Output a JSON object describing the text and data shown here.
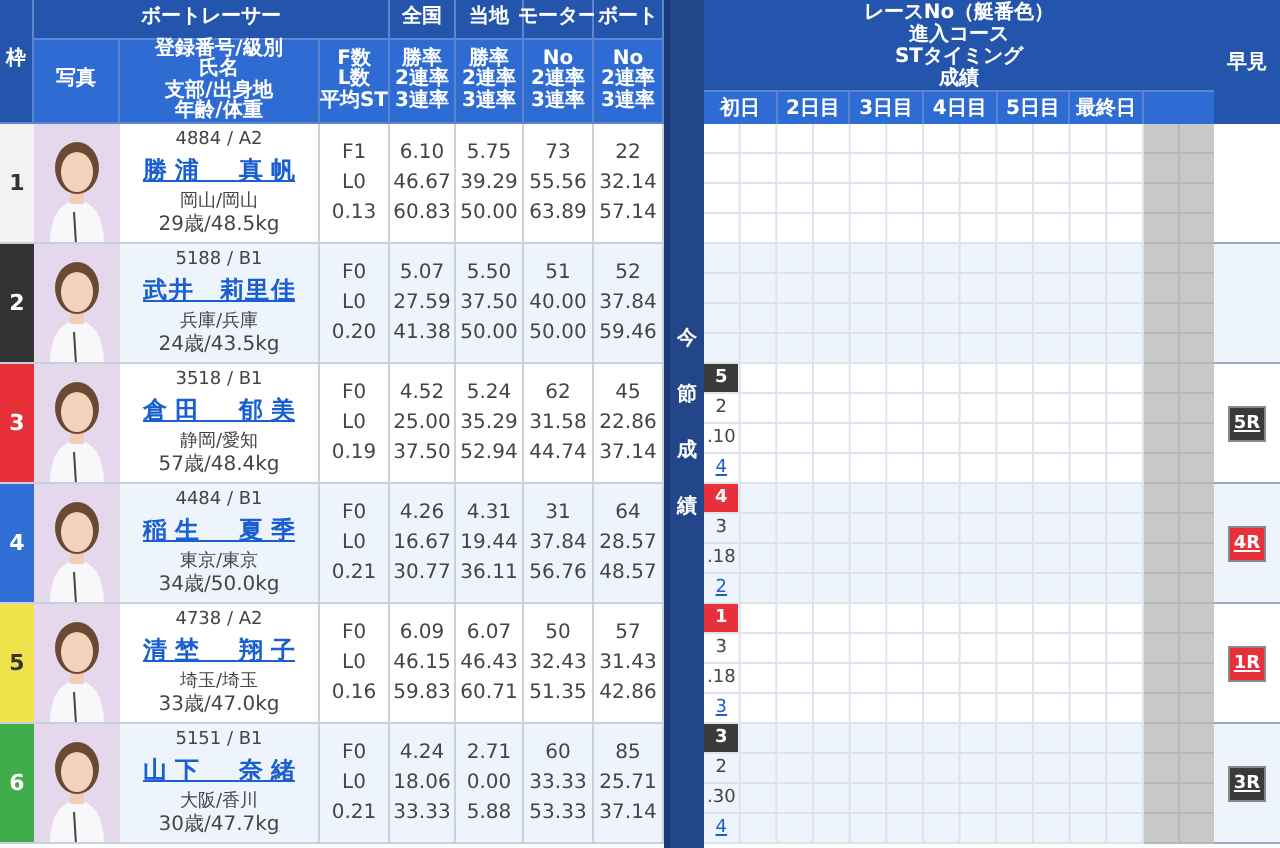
{
  "header": {
    "frame": "枠",
    "racer_group": "ボートレーサー",
    "photo": "写真",
    "racer_lines": [
      "登録番号/級別",
      "氏名",
      "支部/出身地",
      "年齢/体重"
    ],
    "fl_lines": [
      "F数",
      "L数",
      "平均ST"
    ],
    "stats": [
      {
        "title": "全国",
        "lines": [
          "勝率",
          "2連率",
          "3連率"
        ]
      },
      {
        "title": "当地",
        "lines": [
          "勝率",
          "2連率",
          "3連率"
        ]
      },
      {
        "title": "モーター",
        "lines": [
          "No",
          "2連率",
          "3連率"
        ]
      },
      {
        "title": "ボート",
        "lines": [
          "No",
          "2連率",
          "3連率"
        ]
      }
    ],
    "results_title": [
      "レースNo（艇番色）",
      "進入コース",
      "STタイミング",
      "成績"
    ],
    "days": [
      "初日",
      "2日目",
      "3日目",
      "4日目",
      "5日目",
      "最終日"
    ],
    "early": "早見"
  },
  "band": "今節成績",
  "racers": [
    {
      "frame": "1",
      "color": "#f2f2f2",
      "reg": "4884 / A2",
      "name": "勝浦　真帆",
      "home": "岡山/岡山",
      "age_weight": "29歳/48.5kg",
      "fl": [
        "F1",
        "L0",
        "0.13"
      ],
      "stats": [
        [
          "6.10",
          "46.67",
          "60.83"
        ],
        [
          "5.75",
          "39.29",
          "50.00"
        ],
        [
          "73",
          "55.56",
          "63.89"
        ],
        [
          "22",
          "32.14",
          "57.14"
        ]
      ]
    },
    {
      "frame": "2",
      "color": "#333333",
      "reg": "5188 / B1",
      "name": "武井　莉里佳",
      "home": "兵庫/兵庫",
      "age_weight": "24歳/43.5kg",
      "fl": [
        "F0",
        "L0",
        "0.20"
      ],
      "stats": [
        [
          "5.07",
          "27.59",
          "41.38"
        ],
        [
          "5.50",
          "37.50",
          "50.00"
        ],
        [
          "51",
          "40.00",
          "50.00"
        ],
        [
          "52",
          "37.84",
          "59.46"
        ]
      ]
    },
    {
      "frame": "3",
      "color": "#e8303a",
      "reg": "3518 / B1",
      "name": "倉田　郁美",
      "home": "静岡/愛知",
      "age_weight": "57歳/48.4kg",
      "fl": [
        "F0",
        "L0",
        "0.19"
      ],
      "stats": [
        [
          "4.52",
          "25.00",
          "37.50"
        ],
        [
          "5.24",
          "35.29",
          "52.94"
        ],
        [
          "62",
          "31.58",
          "44.74"
        ],
        [
          "45",
          "22.86",
          "37.14"
        ]
      ],
      "results": [
        {
          "race": "5",
          "color": "#3a3a3a",
          "course": "2",
          "st": ".10",
          "finish": "4"
        }
      ],
      "early": {
        "label": "5R",
        "color": "#3a3a3a"
      }
    },
    {
      "frame": "4",
      "color": "#2f6fd6",
      "reg": "4484 / B1",
      "name": "稲生　夏季",
      "home": "東京/東京",
      "age_weight": "34歳/50.0kg",
      "fl": [
        "F0",
        "L0",
        "0.21"
      ],
      "stats": [
        [
          "4.26",
          "16.67",
          "30.77"
        ],
        [
          "4.31",
          "19.44",
          "36.11"
        ],
        [
          "31",
          "37.84",
          "56.76"
        ],
        [
          "64",
          "28.57",
          "48.57"
        ]
      ],
      "results": [
        {
          "race": "4",
          "color": "#e8303a",
          "course": "3",
          "st": ".18",
          "finish": "2"
        }
      ],
      "early": {
        "label": "4R",
        "color": "#e8303a"
      }
    },
    {
      "frame": "5",
      "color": "#f0e24a",
      "reg": "4738 / A2",
      "name": "清埜　翔子",
      "home": "埼玉/埼玉",
      "age_weight": "33歳/47.0kg",
      "fl": [
        "F0",
        "L0",
        "0.16"
      ],
      "stats": [
        [
          "6.09",
          "46.15",
          "59.83"
        ],
        [
          "6.07",
          "46.43",
          "60.71"
        ],
        [
          "50",
          "32.43",
          "51.35"
        ],
        [
          "57",
          "31.43",
          "42.86"
        ]
      ],
      "results": [
        {
          "race": "1",
          "color": "#e8303a",
          "course": "3",
          "st": ".18",
          "finish": "3"
        }
      ],
      "early": {
        "label": "1R",
        "color": "#e8303a"
      }
    },
    {
      "frame": "6",
      "color": "#3fae4a",
      "reg": "5151 / B1",
      "name": "山下　奈緒",
      "home": "大阪/香川",
      "age_weight": "30歳/47.7kg",
      "fl": [
        "F0",
        "L0",
        "0.21"
      ],
      "stats": [
        [
          "4.24",
          "18.06",
          "33.33"
        ],
        [
          "2.71",
          "0.00",
          "5.88"
        ],
        [
          "60",
          "33.33",
          "53.33"
        ],
        [
          "85",
          "25.71",
          "37.14"
        ]
      ],
      "results": [
        {
          "race": "3",
          "color": "#3a3a3a",
          "course": "2",
          "st": ".30",
          "finish": "4"
        }
      ],
      "early": {
        "label": "3R",
        "color": "#3a3a3a"
      }
    }
  ]
}
